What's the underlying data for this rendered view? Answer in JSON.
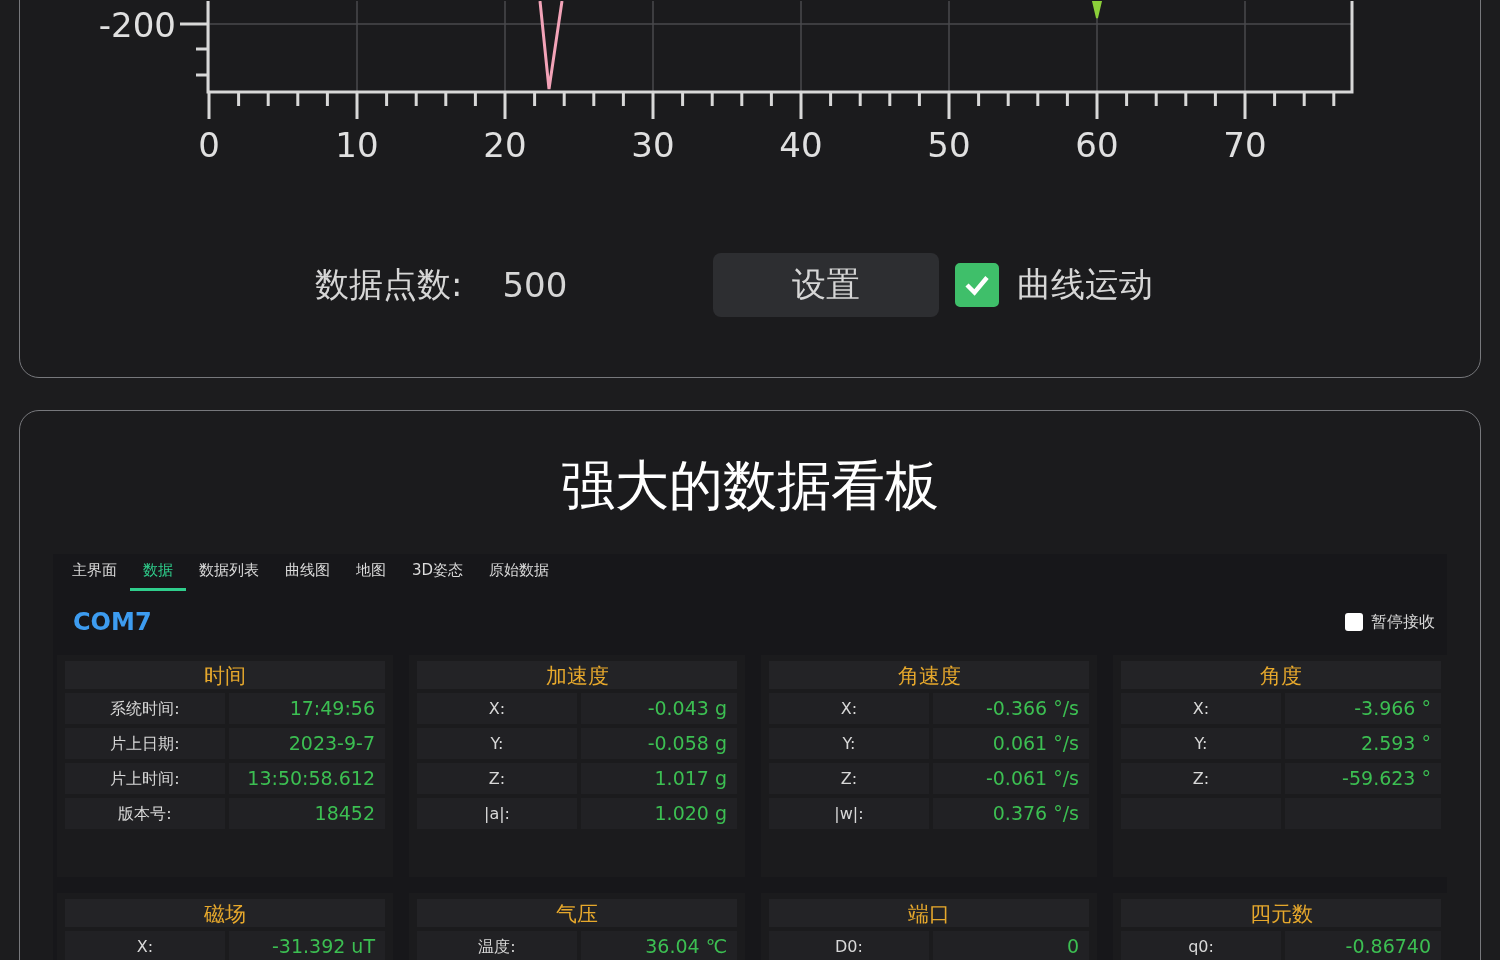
{
  "chart": {
    "y_tick_labels": [
      "-200"
    ],
    "x_tick_labels": [
      "0",
      "10",
      "20",
      "30",
      "40",
      "50",
      "60",
      "70"
    ]
  },
  "controls": {
    "points_label": "数据点数:",
    "points_value": "500",
    "set_button": "设置",
    "curve_motion": {
      "label": "曲线运动",
      "checked": true
    }
  },
  "dashboard": {
    "title": "强大的数据看板",
    "tabs": [
      {
        "label": "主界面",
        "selected": false
      },
      {
        "label": "数据",
        "selected": true
      },
      {
        "label": "数据列表",
        "selected": false
      },
      {
        "label": "曲线图",
        "selected": false
      },
      {
        "label": "地图",
        "selected": false
      },
      {
        "label": "3D姿态",
        "selected": false
      },
      {
        "label": "原始数据",
        "selected": false
      }
    ],
    "port": "COM7",
    "pause": {
      "label": "暂停接收",
      "checked": false
    },
    "panels": [
      {
        "title": "时间",
        "rows": [
          {
            "kind": "data",
            "label": "系统时间:",
            "value": "17:49:56"
          },
          {
            "kind": "data",
            "label": "片上日期:",
            "value": "2023-9-7"
          },
          {
            "kind": "data",
            "label": "片上时间:",
            "value": "13:50:58.612"
          },
          {
            "kind": "data",
            "label": "版本号:",
            "value": "18452"
          }
        ]
      },
      {
        "title": "加速度",
        "rows": [
          {
            "kind": "data",
            "label": "X:",
            "value": "-0.043 g"
          },
          {
            "kind": "data",
            "label": "Y:",
            "value": "-0.058 g"
          },
          {
            "kind": "data",
            "label": "Z:",
            "value": "1.017 g"
          },
          {
            "kind": "data",
            "label": "|a|:",
            "value": "1.020 g"
          }
        ]
      },
      {
        "title": "角速度",
        "rows": [
          {
            "kind": "data",
            "label": "X:",
            "value": "-0.366 °/s"
          },
          {
            "kind": "data",
            "label": "Y:",
            "value": "0.061 °/s"
          },
          {
            "kind": "data",
            "label": "Z:",
            "value": "-0.061 °/s"
          },
          {
            "kind": "data",
            "label": "|w|:",
            "value": "0.376 °/s"
          }
        ]
      },
      {
        "title": "角度",
        "rows": [
          {
            "kind": "data",
            "label": "X:",
            "value": "-3.966 °"
          },
          {
            "kind": "data",
            "label": "Y:",
            "value": "2.593 °"
          },
          {
            "kind": "data",
            "label": "Z:",
            "value": "-59.623 °"
          },
          {
            "kind": "blank"
          }
        ]
      },
      {
        "title": "磁场",
        "rows": [
          {
            "kind": "data",
            "label": "X:",
            "value": "-31.392 uT"
          }
        ]
      },
      {
        "title": "气压",
        "rows": [
          {
            "kind": "data",
            "label": "温度:",
            "value": "36.04 ℃"
          }
        ]
      },
      {
        "title": "端口",
        "rows": [
          {
            "kind": "data",
            "label": "D0:",
            "value": "0"
          }
        ]
      },
      {
        "title": "四元数",
        "rows": [
          {
            "kind": "data",
            "label": "q0:",
            "value": "-0.86740"
          }
        ]
      }
    ]
  }
}
